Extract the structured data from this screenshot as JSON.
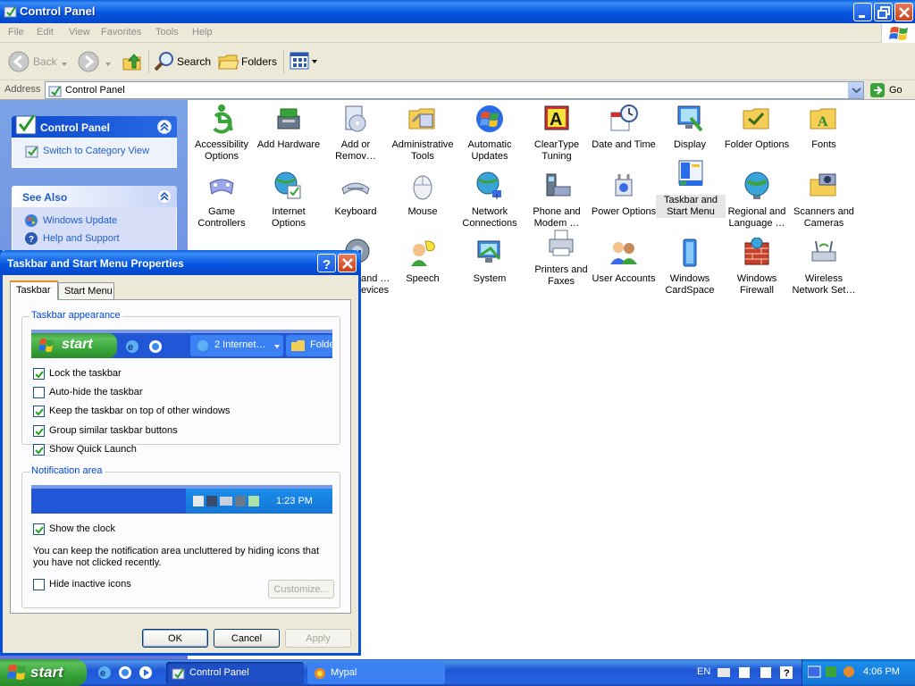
{
  "window": {
    "title": "Control Panel",
    "menu": [
      "File",
      "Edit",
      "View",
      "Favorites",
      "Tools",
      "Help"
    ],
    "toolbar": {
      "back": "Back",
      "search": "Search",
      "folders": "Folders"
    },
    "address": {
      "label": "Address",
      "value": "Control Panel",
      "go": "Go"
    }
  },
  "sidepanel": {
    "control_panel": {
      "title": "Control Panel",
      "link": "Switch to Category View"
    },
    "see_also": {
      "title": "See Also",
      "links": [
        "Windows Update",
        "Help and Support"
      ]
    }
  },
  "icons": [
    {
      "label": "Accessibility Options",
      "icon": "accessibility-icon"
    },
    {
      "label": "Add Hardware",
      "icon": "add-hardware-icon"
    },
    {
      "label": "Add or Remov…",
      "icon": "add-remove-programs-icon"
    },
    {
      "label": "Administrative Tools",
      "icon": "administrative-tools-icon"
    },
    {
      "label": "Automatic Updates",
      "icon": "automatic-updates-icon"
    },
    {
      "label": "ClearType Tuning",
      "icon": "cleartype-icon"
    },
    {
      "label": "Date and Time",
      "icon": "date-time-icon"
    },
    {
      "label": "Display",
      "icon": "display-icon"
    },
    {
      "label": "Folder Options",
      "icon": "folder-options-icon"
    },
    {
      "label": "Fonts",
      "icon": "fonts-icon"
    },
    {
      "label": "Game Controllers",
      "icon": "game-controllers-icon"
    },
    {
      "label": "Internet Options",
      "icon": "internet-options-icon"
    },
    {
      "label": "Keyboard",
      "icon": "keyboard-icon"
    },
    {
      "label": "Mouse",
      "icon": "mouse-icon"
    },
    {
      "label": "Network Connections",
      "icon": "network-connections-icon"
    },
    {
      "label": "Phone and Modem …",
      "icon": "phone-modem-icon"
    },
    {
      "label": "Power Options",
      "icon": "power-options-icon"
    },
    {
      "label": "Taskbar and Start Menu",
      "icon": "taskbar-start-menu-icon"
    },
    {
      "label": "Regional and Language …",
      "icon": "regional-language-icon"
    },
    {
      "label": "Scanners and Cameras",
      "icon": "scanners-cameras-icon"
    },
    {
      "label": "and …evices",
      "icon": "printers-faxes-partial-icon"
    },
    {
      "label": "Speech",
      "icon": "speech-icon"
    },
    {
      "label": "System",
      "icon": "system-icon"
    },
    {
      "label": "Printers and Faxes",
      "icon": "printers-faxes-icon"
    },
    {
      "label": "User Accounts",
      "icon": "user-accounts-icon"
    },
    {
      "label": "Windows CardSpace",
      "icon": "cardspace-icon"
    },
    {
      "label": "Windows Firewall",
      "icon": "firewall-icon"
    },
    {
      "label": "Wireless Network Set…",
      "icon": "wireless-network-icon"
    }
  ],
  "dialog": {
    "title": "Taskbar and Start Menu Properties",
    "tabs": [
      "Taskbar",
      "Start Menu"
    ],
    "appearance": {
      "title": "Taskbar appearance",
      "preview": {
        "start": "start",
        "task": "2 Internet…",
        "folder": "Folde"
      },
      "options": [
        {
          "label": "Lock the taskbar",
          "checked": true
        },
        {
          "label": "Auto-hide the taskbar",
          "checked": false
        },
        {
          "label": "Keep the taskbar on top of other windows",
          "checked": true
        },
        {
          "label": "Group similar taskbar buttons",
          "checked": true
        },
        {
          "label": "Show Quick Launch",
          "checked": true
        }
      ]
    },
    "notification": {
      "title": "Notification area",
      "preview_time": "1:23 PM",
      "show_clock": {
        "label": "Show the clock",
        "checked": true
      },
      "description": "You can keep the notification area uncluttered by hiding icons that you have not clicked recently.",
      "hide_inactive": {
        "label": "Hide inactive icons",
        "checked": false
      },
      "customize": "Customize..."
    },
    "buttons": {
      "ok": "OK",
      "cancel": "Cancel",
      "apply": "Apply"
    }
  },
  "taskbar": {
    "start": "start",
    "tasks": [
      "Control Panel",
      "Mypal"
    ],
    "language": "EN",
    "clock": "4:06 PM"
  }
}
